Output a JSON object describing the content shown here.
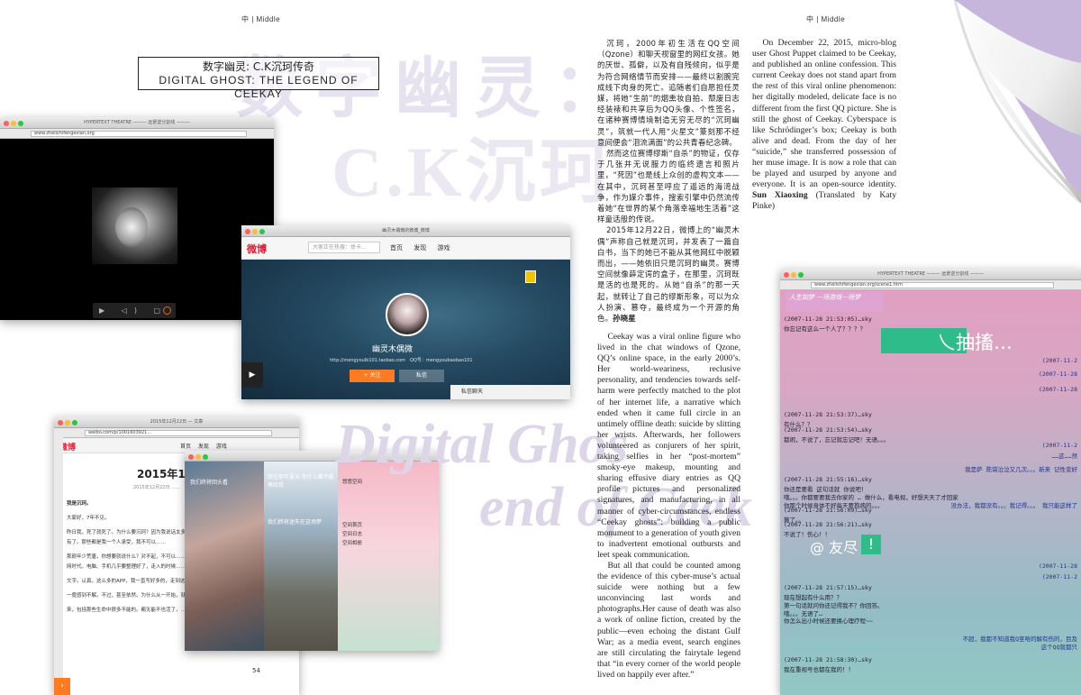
{
  "running_head": {
    "left": "中 | Middle",
    "right": "中 | Middle"
  },
  "background_title": {
    "line1": "数字幽灵：",
    "line2": "C.K沉珂",
    "line3": "Digital Ghos",
    "line4": "end of Ceek"
  },
  "title_box": {
    "zh": "数字幽灵: C.K沉珂传奇",
    "en": "DIGITAL GHOST: THE LEGEND OF CEEKAY"
  },
  "screens": {
    "video": {
      "window_title": "HYPERTEXT THEATRE ——— 远景逆分割线 ———",
      "url": "www.zhelishifengexian.org",
      "controls": "▶ ◁) ▢ ⤢"
    },
    "weibo_profile": {
      "window_title": "幽灵木偶微的微博_微博",
      "url": "www.weibo.com/...",
      "logo": "微博",
      "search_placeholder": "大家正在热搜：徐卡…",
      "nav": "首页 发现 游戏",
      "name": "幽灵木偶微",
      "sub": "http://mengyoulb101.taobao.com　QQ号：mengyoubaobao101",
      "follow": "+ 关注",
      "message": "私信",
      "chat": "私信聊天",
      "side_play": "▶"
    },
    "weibo_article": {
      "window_title": "2015年12月22日 — 文章",
      "url": "weibo.com/p/1001603921...",
      "logo": "微博",
      "nav": "首页 发现 游戏",
      "date_title": "2015年12月",
      "date_sub": "2015年12月22日 ……",
      "lines": [
        "我是沉珂。",
        "大家好，7年不见。",
        "昨日我，死了就死了。为什么要沉珂？因为我说话太多，为什么是我，那天好多人上来问，那我没有了。那些都是我一个人承受，我不可以……",
        "那颜年少荒唐，你想要就说什么？对不起，不可以……我说说我怎么去世……我想要，现在是互联网时代。电脑、手机几乎要整理好了，走入的时候……",
        "文字。认真，这么多的APP，我一直写好多的，走到这世上来……我还是没有见到……",
        "一度感到不解。不过，甚至依然。为什么从一开始，就选择了……",
        "来，包括那些生命中很多不能的。都无能不也活了，……"
      ],
      "page_no": "54",
      "left_tab": "›"
    },
    "qq_collage": {
      "top_label": "我们终将回头看",
      "handwriting": "就在那年夏天 你什么都不能再给我",
      "side_label": "我们终将迷失在这场梦",
      "list1": "悠悠空间",
      "list2": "空间首页",
      "list3": "空间日志",
      "list4": "空间相册"
    },
    "hypertext": {
      "window_title": "HYPERTEXT THEATRE ——— 远景逆分割线 ———",
      "url": "www.zhelishifengexian.org/scene1.htm",
      "logo": "人生如梦 一场游戏一场梦",
      "big_text": "乀抽搐…",
      "at_text": "@ 友尽",
      "exclaim": "!",
      "lines": [
        {
          "t": "(2007-11-28 21:53:05)…sky",
          "cls": ""
        },
        {
          "t": "你忘记有这么一个人了？？？？",
          "cls": ""
        },
        {
          "t": "(2007-11-28 21:53:37)…sky",
          "cls": ""
        },
        {
          "t": "有什么？？",
          "cls": ""
        },
        {
          "t": "(2007-11-28 21:53:54)…sky",
          "cls": ""
        },
        {
          "t": "都闹，不说了，忘记就忘记吧！无语。。。",
          "cls": ""
        },
        {
          "t": "(2007-11-28 21:55:16)…sky",
          "cls": ""
        },
        {
          "t": "你还是要看 这句话就 你说吧！",
          "cls": ""
        },
        {
          "t": "哦。。。你都要要我去你家的 … 做什么，看电视，好想天天了才回家",
          "cls": ""
        },
        {
          "t": "你那个时候身体不好每天要抱病的。。。",
          "cls": ""
        },
        {
          "t": "(2007-11-28 21:56:09)…sky",
          "cls": ""
        },
        {
          "t": "算了。。",
          "cls": ""
        },
        {
          "t": "(2007-11-28 21:56:21)…sky",
          "cls": ""
        },
        {
          "t": "不说了！伤心！！",
          "cls": ""
        },
        {
          "t": "(2007-11-28 21:57:15)…sky",
          "cls": ""
        },
        {
          "t": "现在想起有什么用？？",
          "cls": ""
        },
        {
          "t": "第一句话就问你还记得我不？你回答。",
          "cls": ""
        },
        {
          "t": "哦。。。无语了…",
          "cls": ""
        },
        {
          "t": "你怎么出小时候还要换心理疗程~~",
          "cls": ""
        },
        {
          "t": "(2007-11-28 21:58:30)…sky",
          "cls": ""
        },
        {
          "t": "我在重视号也都在我的！！",
          "cls": ""
        }
      ],
      "right_lines": [
        "(2007-11-2",
        "(2007-11-28",
        "(2007-11-28",
        "(2007-11-2",
        "……这……然",
        "我是萨 陈袋泣泣又几次。。。新来 记性变好",
        "没办法，我都没有。。。我记得。。。 我只能这样了",
        "(2007-11-28",
        "(2007-11-2",
        "不超，我都不知道我Q至哈的解有伤的，目及",
        "这个QQ就都只"
      ]
    }
  },
  "text_zh": {
    "p1": "沉珂，2000年初生活在QQ空间（Qzone）和聊天视窗里的网红女孩。她的厌世、孤僻，以及有自残倾向，似乎是为符合网络情节而安排——最终以割腕完成线下肉身的死亡。追随者们自愿担任灵媒，将她“生前”的烟熏妆自拍、颓废日志经装裱和共享后为QQ头像、个性签名，在诸种赛博情境制造无穷无尽的“沉珂幽灵”，筑就一代人用“火星文”篆刻那不经意间便会“泪流满面”的公共青春纪念碑。",
    "p2": "然而这位赛博缪斯“自杀”的物证，仅存于几张并无说服力的临终遗言和照片里，“死因”也是线上众创的虚构文本——在其中，沉珂甚至呼应了遥远的海湾战争，作为媒介事件，搜索引擎中仍然流传着她“在世界的某个角落幸福地生活着”这样童话般的传说。",
    "p3": "2015年12月22日，微博上的“幽灵木偶”声称自己就是沉珂，并发表了一篇自白书，当下的她已不能从其他网红中脱颖而出，——她依旧只是沉珂的幽灵。赛博空间就像薛定谔的盒子，在那里，沉珂既是活的也是死的。从她“自杀”的那一天起，就转让了自己的缪斯形象，可以为众人扮演、篡夺，最终成为一个开源的角色。",
    "author": "孙晓星"
  },
  "text_en": {
    "p1": "Ceekay was a viral online figure who lived in the chat windows of Qzone, QQ’s online space, in the early 2000’s. Her world-weariness, reclusive personality, and tendencies towards self-harm were perfectly matched to the plot of her internet life, a narrative which ended when it came full circle in an untimely offline death: suicide by slitting her wrists. Afterwards, her followers volunteered as conjurers of her spirit, taking selfies in her “post-mortem” smoky-eye makeup, mounting and sharing effusive diary entries as QQ profile pictures and personalized signatures, and manufacturing, in all manner of cyber-circumstances, endless “Ceekay ghosts”: building a public monument to a generation of youth given to inadvertent emotional outbursts and leet speak communication.",
    "p2": "But all that could be counted among the evidence of this cyber-muse’s actual suicide were nothing but a few unconvincing last words and photographs.Her cause of death was also a work of online fiction, created by the public—even echoing the distant Gulf War; as a media event, search engines are still circulating the fairytale legend that “in every corner of the world people lived on happily ever after.”",
    "p3": "On December 22, 2015, micro-blog user Ghost Puppet claimed to be Ceekay, and published an online confession. This current Ceekay does not stand apart from the rest of this viral online phenomenon: her digitally modeled, delicate face is no different from the first QQ picture. She is still the ghost of Ceekay. Cyberspace is like Schrödinger’s box; Ceekay is both alive and dead. From the day of her “suicide,” she transferred possession of her muse image. It is now a role that can be played and usurped by anyone and everyone. It is an open-source identity.",
    "author": "Sun Xiaoxing",
    "translator": "(Translated by Katy Pinke)"
  },
  "colors": {
    "fold": "#c9b9dd",
    "accent_green": "#2ebd8a",
    "weibo_red": "#e6162d",
    "orange": "#ff7b22"
  }
}
